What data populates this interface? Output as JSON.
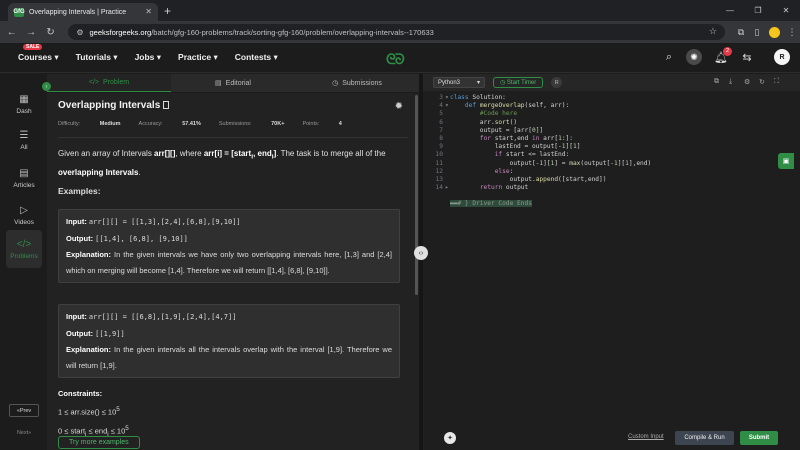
{
  "browser": {
    "tab_title": "Overlapping Intervals | Practice",
    "favicon_text": "GfG",
    "url_domain": "geeksforgeeks.org",
    "url_path": "/batch/gfg-160-problems/track/sorting-gfg-160/problem/overlapping-intervals--170633"
  },
  "site_nav": {
    "sale_badge": "SALE",
    "items": [
      "Courses",
      "Tutorials",
      "Jobs",
      "Practice",
      "Contests"
    ],
    "logo": "GG",
    "notification_count": "2",
    "avatar_letter": "R"
  },
  "sidebar": {
    "items": [
      {
        "label": "Dash",
        "icon": "grid-icon"
      },
      {
        "label": "All",
        "icon": "list-icon"
      },
      {
        "label": "Articles",
        "icon": "article-icon"
      },
      {
        "label": "Videos",
        "icon": "video-icon"
      },
      {
        "label": "Problems",
        "icon": "code-icon"
      }
    ],
    "prev_label": "Prev",
    "next_label": "Next"
  },
  "problem_tabs": [
    {
      "label": "Problem",
      "icon": "</>"
    },
    {
      "label": "Editorial",
      "icon": "▤"
    },
    {
      "label": "Submissions",
      "icon": "◷"
    }
  ],
  "problem": {
    "title": "Overlapping Intervals",
    "difficulty_label": "Difficulty:",
    "difficulty": "Medium",
    "accuracy_label": "Accuracy:",
    "accuracy": "57.41%",
    "submissions_label": "Submissions:",
    "submissions": "70K+",
    "points_label": "Points:",
    "points": "4",
    "desc_pre": "Given an array of Intervals ",
    "desc_arr": "arr[][]",
    "desc_mid": ", where ",
    "desc_def": "arr[i] = [start",
    "desc_i": "i",
    "desc_end": ", end",
    "desc_close": "]",
    "desc_post": ". The task is to merge all of the ",
    "desc_bold": "overlapping Intervals",
    "desc_dot": ".",
    "examples_title": "Examples:",
    "examples": [
      {
        "input_label": "Input:",
        "input": "arr[][] = [[1,3],[2,4],[6,8],[9,10]]",
        "output_label": "Output:",
        "output": "[[1,4], [6,8], [9,10]]",
        "explanation_label": "Explanation:",
        "explanation": "In the given intervals we have only two overlapping intervals here, [1,3] and [2,4] which on merging will become [1,4]. Therefore we will return [[1,4], [6,8], [9,10]]."
      },
      {
        "input_label": "Input:",
        "input": "arr[][] = [[6,8],[1,9],[2,4],[4,7]]",
        "output_label": "Output:",
        "output": "[[1,9]]",
        "explanation_label": "Explanation:",
        "explanation": "In the given intervals all the intervals overlap with the interval [1,9]. Therefore we will return [1,9]."
      }
    ],
    "constraints_title": "Constraints:",
    "c1_pre": "1 ≤ arr.size() ≤ 10",
    "c1_exp": "5",
    "c2_pre": "0 ≤ start",
    "c2_sub1": "i",
    "c2_mid": " ≤ end",
    "c2_sub2": "i",
    "c2_post": " ≤ 10",
    "c2_exp": "5",
    "try_more": "Try more examples"
  },
  "editor": {
    "language": "Python3",
    "timer_label": "Start Timer",
    "line_numbers": [
      "3",
      "4",
      "5",
      "6",
      "7",
      "8",
      "9",
      "10",
      "11",
      "12",
      "13",
      "14"
    ],
    "custom_input": "Custom Input",
    "compile_label": "Compile & Run",
    "submit_label": "Submit"
  },
  "colors": {
    "brand_green": "#2f8d46",
    "background": "#1c1c1c"
  }
}
